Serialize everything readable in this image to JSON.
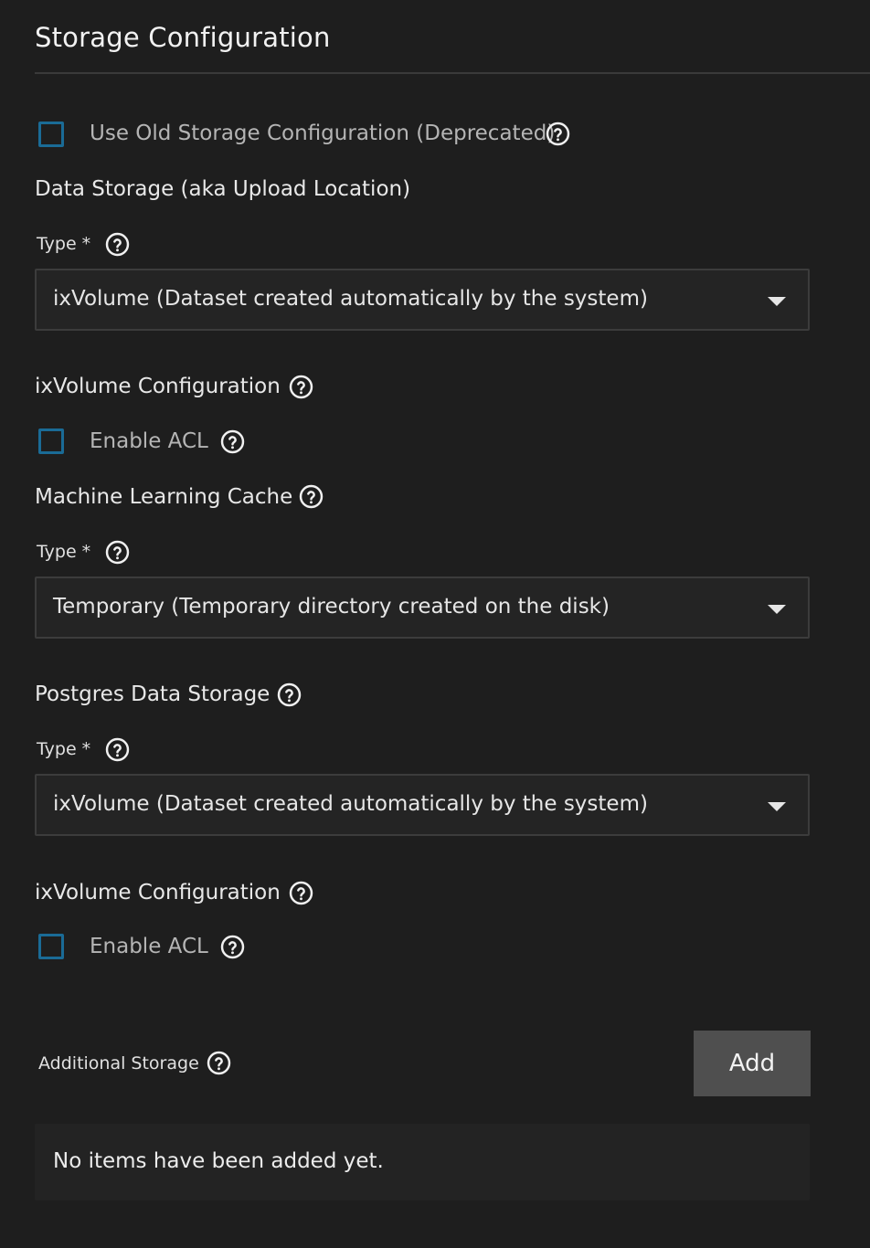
{
  "header": {
    "title": "Storage Configuration"
  },
  "old_storage": {
    "label": "Use Old Storage Configuration (Deprecated)",
    "checked": false
  },
  "data_storage": {
    "heading": "Data Storage (aka Upload Location)",
    "type_label": "Type *",
    "type_value": "ixVolume (Dataset created automatically by the system)",
    "ixvolume_heading": "ixVolume Configuration",
    "acl_label": "Enable ACL"
  },
  "ml_cache": {
    "heading": "Machine Learning Cache",
    "type_label": "Type *",
    "type_value": "Temporary (Temporary directory created on the disk)"
  },
  "postgres": {
    "heading": "Postgres Data Storage",
    "type_label": "Type *",
    "type_value": "ixVolume (Dataset created automatically by the system)",
    "ixvolume_heading": "ixVolume Configuration",
    "acl_label": "Enable ACL"
  },
  "additional": {
    "label": "Additional Storage",
    "add_label": "Add",
    "empty_text": "No items have been added yet."
  },
  "icons": {
    "help": "help-circle-icon",
    "dropdown": "caret-down-icon"
  },
  "colors": {
    "background": "#1e1e1e",
    "checkbox_border": "#1a6b96",
    "button": "#4f4f4f"
  }
}
